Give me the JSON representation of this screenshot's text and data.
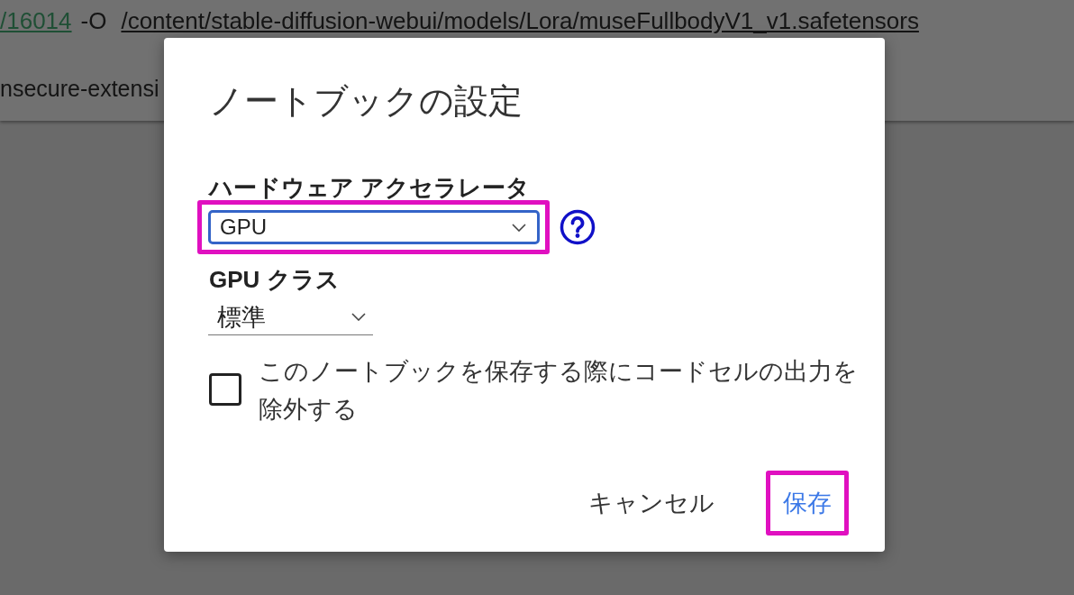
{
  "output": {
    "lines": [
      {
        "count": "/16014",
        "flag": "-O",
        "path": "/content/stable-diffusion-webui/models/Lora/museFullbodyV1_v1.safetensors"
      }
    ],
    "trailing_text": "nsecure-extensi"
  },
  "dialog": {
    "title": "ノートブックの設定",
    "fields": [
      {
        "kind": "boxed",
        "label": "ハードウェア アクセラレータ",
        "value": "GPU",
        "focused": true,
        "highlighted": true,
        "help": true
      },
      {
        "kind": "underlined",
        "label": "GPU クラス",
        "value": "標準",
        "focused": false,
        "highlighted": false,
        "help": false
      }
    ],
    "checkbox": {
      "label": "このノートブックを保存する際にコードセルの出力を除外する",
      "checked": false
    },
    "buttons": [
      {
        "kind": "text",
        "label": "キャンセル",
        "highlighted": false
      },
      {
        "kind": "primary",
        "label": "保存",
        "highlighted": true
      }
    ]
  }
}
